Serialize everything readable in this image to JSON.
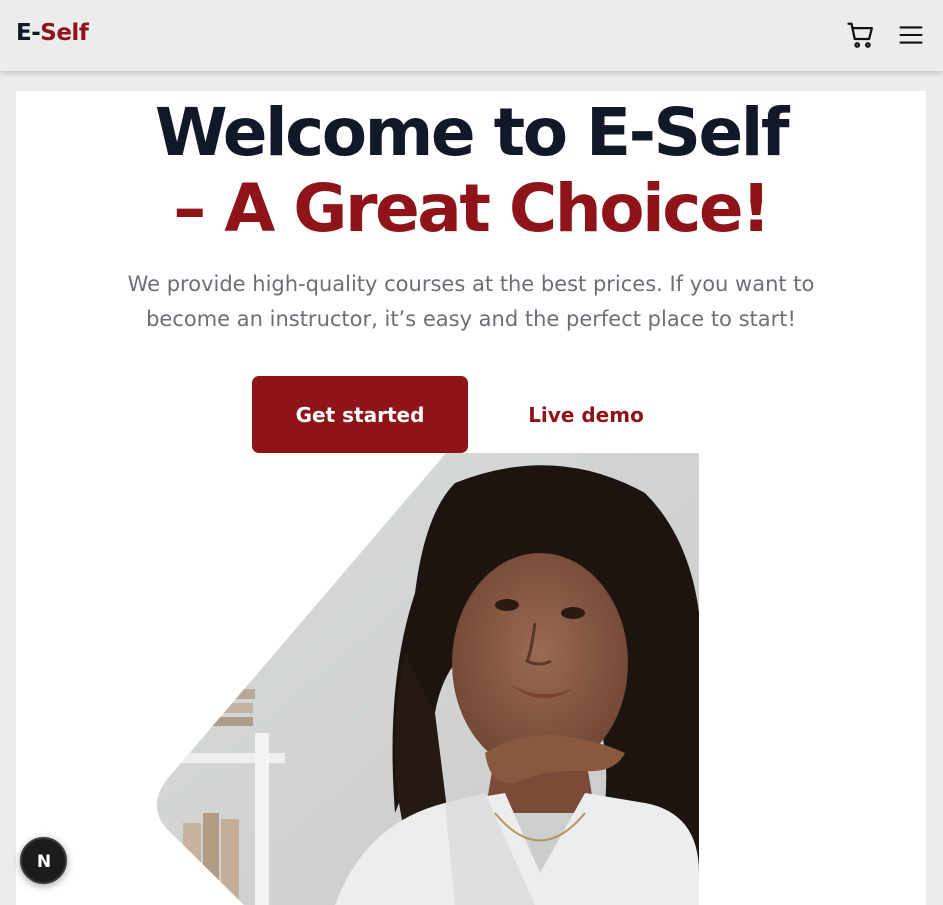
{
  "header": {
    "logo_part1": "E-",
    "logo_part2": "Self",
    "cart_icon": "cart-icon",
    "menu_icon": "hamburger-menu-icon"
  },
  "hero": {
    "title_line1": "Welcome to E-Self",
    "title_line2": "– A Great Choice!",
    "subtitle": "We provide high-quality courses at the best prices. If you want to become an instructor, it’s easy and the perfect place to start!",
    "primary_button": "Get started",
    "secondary_button": "Live demo"
  },
  "dev_badge": {
    "letter": "N",
    "icon": "nextjs-logo-icon"
  },
  "colors": {
    "brand": "#8f1419",
    "dark_text": "#111827",
    "muted_text": "#6b6f76",
    "page_bg": "#ececec",
    "card_bg": "#ffffff"
  }
}
